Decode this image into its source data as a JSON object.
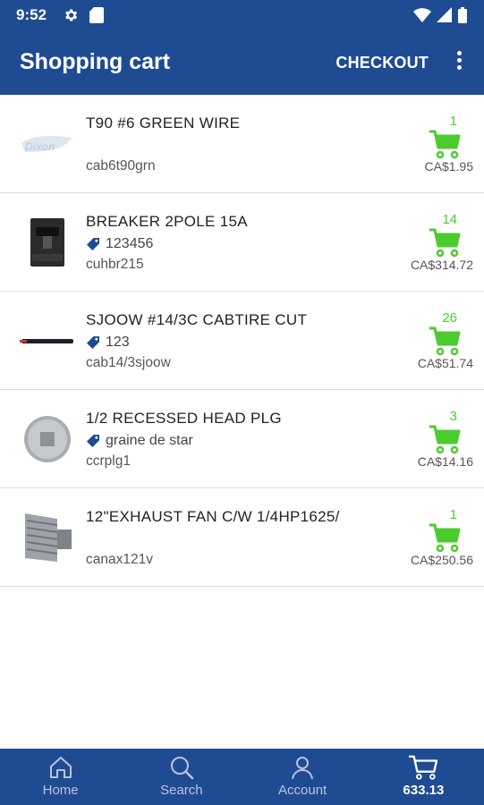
{
  "status_bar": {
    "time": "9:52"
  },
  "app_bar": {
    "title": "Shopping cart",
    "checkout_label": "CHECKOUT"
  },
  "items": [
    {
      "name": "T90 #6 GREEN WIRE",
      "tag": "",
      "sku": "cab6t90grn",
      "qty": "1",
      "price": "CA$1.95",
      "thumb": "dixon-logo-image"
    },
    {
      "name": "BREAKER 2POLE 15A",
      "tag": "123456",
      "sku": "cuhbr215",
      "qty": "14",
      "price": "CA$314.72",
      "thumb": "breaker-image"
    },
    {
      "name": "SJOOW #14/3C CABTIRE CUT",
      "tag": "123",
      "sku": "cab14/3sjoow",
      "qty": "26",
      "price": "CA$51.74",
      "thumb": "cable-image"
    },
    {
      "name": "1/2 RECESSED HEAD PLG",
      "tag": "graine de star",
      "sku": "ccrplg1",
      "qty": "3",
      "price": "CA$14.16",
      "thumb": "plug-image"
    },
    {
      "name": "12\"EXHAUST FAN C/W 1/4HP1625/",
      "tag": "",
      "sku": "canax121v",
      "qty": "1",
      "price": "CA$250.56",
      "thumb": "exhaust-fan-image"
    }
  ],
  "bottom_nav": {
    "home": "Home",
    "search": "Search",
    "account": "Account",
    "cart_total": "633.13"
  },
  "colors": {
    "primary": "#1f4b93",
    "accent_green": "#4ccb2f",
    "tag_blue": "#1f4b93"
  },
  "thumb_text": {
    "dixon": "Dixon"
  }
}
